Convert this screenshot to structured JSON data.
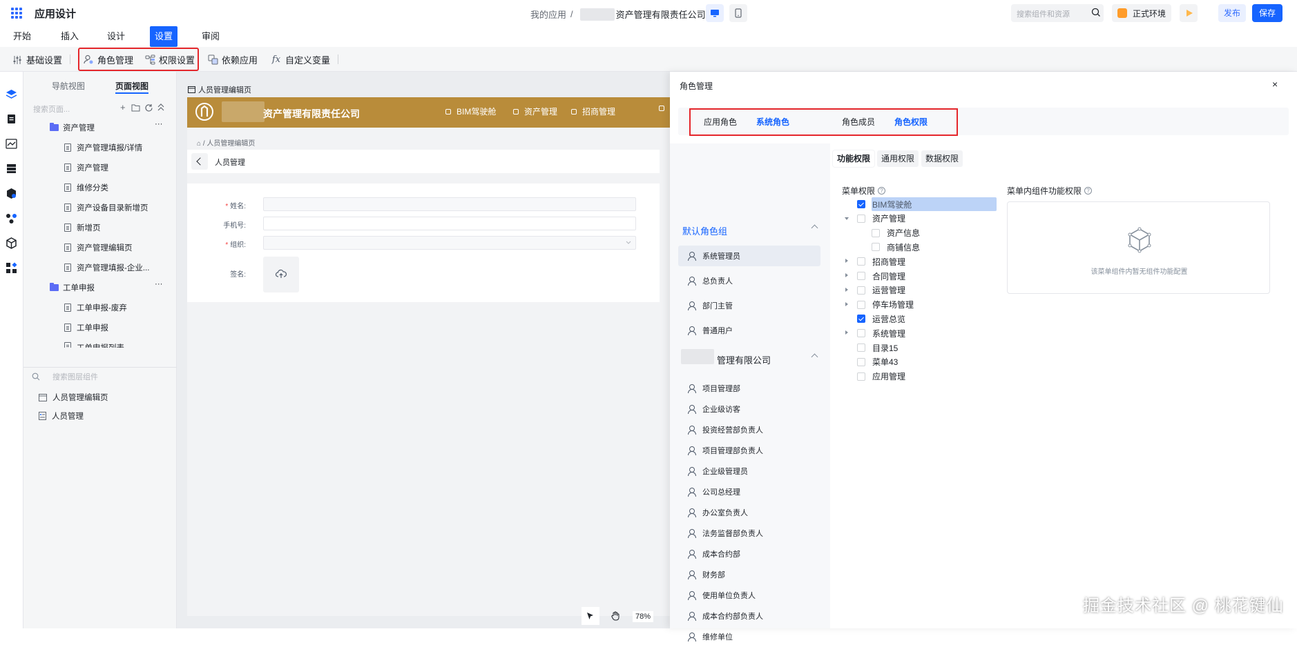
{
  "header": {
    "app_title": "应用设计",
    "breadcrumb_root": "我的应用",
    "breadcrumb_sep": "/",
    "company_suffix": "资产管理有限责任公司",
    "search_placeholder": "搜索组件和资源",
    "env_label": "正式环境",
    "publish_label": "发布",
    "save_label": "保存"
  },
  "menu_tabs": [
    "开始",
    "插入",
    "设计",
    "设置",
    "审阅"
  ],
  "active_menu_tab": "设置",
  "toolbar": {
    "basic": "基础设置",
    "role": "角色管理",
    "permission": "权限设置",
    "dependency": "依赖应用",
    "variable": "自定义变量"
  },
  "tree_panel": {
    "tabs": [
      "导航视图",
      "页面视图"
    ],
    "active_tab": "页面视图",
    "search_placeholder": "搜索页面...",
    "folders": [
      {
        "label": "资产管理",
        "children": [
          "资产管理填报/详情",
          "资产管理",
          "维修分类",
          "资产设备目录新增页",
          "新增页",
          "资产管理编辑页",
          "资产管理填报-企业..."
        ]
      },
      {
        "label": "工单申报",
        "children": [
          "工单申报-废弃",
          "工单申报",
          "工单申报列表"
        ]
      }
    ],
    "layer_search_placeholder": "搜索图层组件",
    "layers": [
      "人员管理编辑页",
      "人员管理"
    ]
  },
  "canvas": {
    "page_label": "人员管理编辑页",
    "preview_company": "资产管理有限责任公司",
    "nav": [
      "BIM驾驶舱",
      "资产管理",
      "招商管理"
    ],
    "crumb": "⌂ / 人员管理编辑页",
    "bar_title": "人员管理",
    "fields": [
      {
        "label": "姓名:",
        "required": "*"
      },
      {
        "label": "手机号:",
        "required": ""
      },
      {
        "label": "组织:",
        "required": "*"
      },
      {
        "label": "签名:",
        "required": ""
      }
    ],
    "zoom": "78%"
  },
  "role_panel": {
    "title": "角色管理",
    "close": "×",
    "tabs_left": [
      "应用角色",
      "系统角色"
    ],
    "tabs_right": [
      "角色成员",
      "角色权限"
    ],
    "active_left": "系统角色",
    "active_right": "角色权限",
    "group1": "默认角色组",
    "group1_roles": [
      "系统管理员",
      "总负责人",
      "部门主管",
      "普通用户"
    ],
    "group2_suffix": "管理有限公司",
    "group2_roles": [
      "项目管理部",
      "企业级访客",
      "投资经营部负责人",
      "项目管理部负责人",
      "企业级管理员",
      "公司总经理",
      "办公室负责人",
      "法务监督部负责人",
      "成本合约部",
      "财务部",
      "使用单位负责人",
      "成本合约部负责人",
      "维修单位"
    ],
    "selected_role": "系统管理员",
    "perm_tabs": [
      "功能权限",
      "通用权限",
      "数据权限"
    ],
    "active_perm_tab": "功能权限",
    "menu_perm_title": "菜单权限",
    "comp_perm_title": "菜单内组件功能权限",
    "comp_empty": "该菜单组件内暂无组件功能配置",
    "menu_items": [
      {
        "label": "BIM驾驶舱",
        "checked": true,
        "arrow": "none",
        "indent": 0
      },
      {
        "label": "资产管理",
        "checked": false,
        "arrow": "down",
        "indent": 0
      },
      {
        "label": "资产信息",
        "checked": false,
        "arrow": "none",
        "indent": 1
      },
      {
        "label": "商铺信息",
        "checked": false,
        "arrow": "none",
        "indent": 1
      },
      {
        "label": "招商管理",
        "checked": false,
        "arrow": "right",
        "indent": 0
      },
      {
        "label": "合同管理",
        "checked": false,
        "arrow": "right",
        "indent": 0
      },
      {
        "label": "运营管理",
        "checked": false,
        "arrow": "right",
        "indent": 0
      },
      {
        "label": "停车场管理",
        "checked": false,
        "arrow": "right",
        "indent": 0
      },
      {
        "label": "运营总览",
        "checked": true,
        "arrow": "none",
        "indent": 0
      },
      {
        "label": "系统管理",
        "checked": false,
        "arrow": "right",
        "indent": 0
      },
      {
        "label": "目录15",
        "checked": false,
        "arrow": "none",
        "indent": 0
      },
      {
        "label": "菜单43",
        "checked": false,
        "arrow": "none",
        "indent": 0
      },
      {
        "label": "应用管理",
        "checked": false,
        "arrow": "none",
        "indent": 0
      }
    ]
  },
  "watermark": "掘金技术社区 @ 桃花键仙",
  "colors": {
    "primary": "#1664ff",
    "highlight": "#e5262b",
    "preview_header": "#b98c3a"
  }
}
